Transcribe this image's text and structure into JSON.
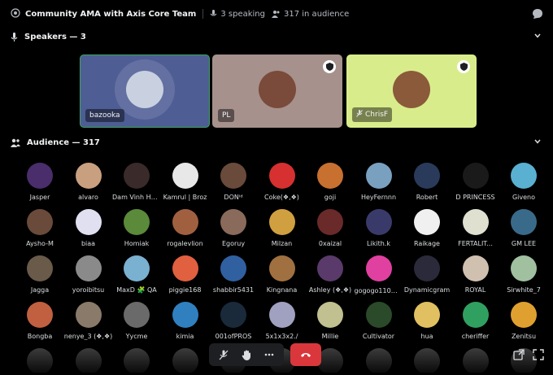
{
  "header": {
    "title": "Community AMA with Axis Core Team",
    "speaking": "3 speaking",
    "audience_count": "317 in audience"
  },
  "speakers_section": {
    "label": "Speakers — 3"
  },
  "speakers": [
    {
      "name": "bazooka",
      "bg": "#4e5d94",
      "border": "#3ba55c",
      "avatar": "#c9d1e0",
      "shield": false,
      "muted": false
    },
    {
      "name": "PL",
      "bg": "#a6918c",
      "border": "#a6918c",
      "avatar": "#7a4a3a",
      "shield": true,
      "muted": false
    },
    {
      "name": "ChrisF",
      "bg": "#d9ec8c",
      "border": "#d9ec8c",
      "avatar": "#8a5a3a",
      "shield": true,
      "muted": true
    }
  ],
  "audience_section": {
    "label": "Audience — 317"
  },
  "audience": [
    {
      "name": "Jasper",
      "c": "#4a2d6b"
    },
    {
      "name": "alvaro",
      "c": "#c8a080"
    },
    {
      "name": "Dam Vinh Hu...",
      "c": "#3a2a2a"
    },
    {
      "name": "Kamrul | Broz",
      "c": "#e8e8e8"
    },
    {
      "name": "DONᴵᵈ",
      "c": "#6a4a3a"
    },
    {
      "name": "Coke(❖,❖)",
      "c": "#d63030"
    },
    {
      "name": "goji",
      "c": "#c87030"
    },
    {
      "name": "HeyFernnn",
      "c": "#7aa0c0"
    },
    {
      "name": "Robert",
      "c": "#2a3a5a"
    },
    {
      "name": "D PRINCESS",
      "c": "#1a1a1a"
    },
    {
      "name": "Giveno",
      "c": "#5ab0d0"
    },
    {
      "name": "Aysho-M",
      "c": "#6a4a3a"
    },
    {
      "name": "biaa",
      "c": "#e0e0f0"
    },
    {
      "name": "Homiak",
      "c": "#5a8a3a"
    },
    {
      "name": "rogalevlion",
      "c": "#a06040"
    },
    {
      "name": "Egoruy",
      "c": "#8a6a5a"
    },
    {
      "name": "Milzan",
      "c": "#d0a040"
    },
    {
      "name": "0xaizal",
      "c": "#6a2a2a"
    },
    {
      "name": "Likith.k",
      "c": "#3a3a6a"
    },
    {
      "name": "Raikage",
      "c": "#f0f0f0"
    },
    {
      "name": "FERTALIT...",
      "c": "#e0e0d0"
    },
    {
      "name": "GM LEE",
      "c": "#3a6a8a"
    },
    {
      "name": "Jagga",
      "c": "#6a5a4a"
    },
    {
      "name": "yoroibitsu",
      "c": "#8a8a8a"
    },
    {
      "name": "MaxD 🧩 QA",
      "c": "#7ab0d0"
    },
    {
      "name": "piggie168",
      "c": "#e06040"
    },
    {
      "name": "shabbir5431",
      "c": "#3060a0"
    },
    {
      "name": "Kingnana",
      "c": "#a07040"
    },
    {
      "name": "Ashley (❖,❖)",
      "c": "#5a3a6a"
    },
    {
      "name": "gogogo110扫...",
      "c": "#e040a0"
    },
    {
      "name": "Dynamicgram",
      "c": "#2a2a3a"
    },
    {
      "name": "ROYAL",
      "c": "#d0c0b0"
    },
    {
      "name": "Sirwhite_7",
      "c": "#a0c0a0"
    },
    {
      "name": "Bongba",
      "c": "#c06040"
    },
    {
      "name": "nenye_3 (❖,❖)",
      "c": "#8a7a6a"
    },
    {
      "name": "Yycme",
      "c": "#6a6a6a"
    },
    {
      "name": "kimia",
      "c": "#3080c0"
    },
    {
      "name": "001ofPROS",
      "c": "#1a2a3a"
    },
    {
      "name": "5x1x3x2./",
      "c": "#a0a0c0"
    },
    {
      "name": "Millie",
      "c": "#c0c090"
    },
    {
      "name": "Cultivator",
      "c": "#2a4a2a"
    },
    {
      "name": "hua",
      "c": "#e0c060"
    },
    {
      "name": "cheriffer",
      "c": "#30a060"
    },
    {
      "name": "Zenitsu",
      "c": "#e0a030"
    }
  ],
  "controls": {
    "mute_icon": "mic-off-icon",
    "raise_hand_icon": "hand-icon",
    "more_icon": "ellipsis-icon",
    "leave_icon": "phone-hangup-icon",
    "leave_color": "#da373c"
  }
}
